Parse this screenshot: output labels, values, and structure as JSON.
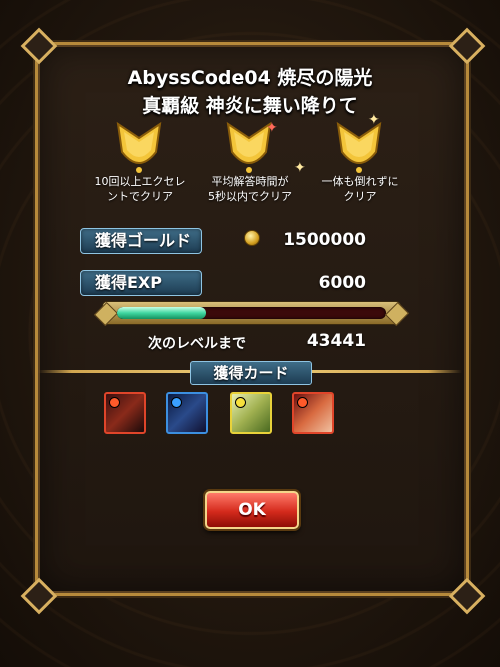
{
  "title": {
    "line1": "AbyssCode04 焼尽の陽光",
    "line2": "真覇級 神炎に舞い降りて"
  },
  "medals": [
    {
      "icon": "gold-crown-medal-icon",
      "label_l1": "10回以上エクセレ",
      "label_l2": "ントでクリア"
    },
    {
      "icon": "gold-crown-medal-icon",
      "label_l1": "平均解答時間が",
      "label_l2": "5秒以内でクリア"
    },
    {
      "icon": "gold-crown-medal-icon",
      "label_l1": "一体も倒れずに",
      "label_l2": "クリア"
    }
  ],
  "gold": {
    "label": "獲得ゴールド",
    "value": "1500000",
    "icon": "gold-coin-icon"
  },
  "exp": {
    "label": "獲得EXP",
    "value": "6000",
    "progress": 0.33
  },
  "next_level": {
    "label": "次のレベルまで",
    "value": "43441"
  },
  "cards": {
    "label": "獲得カード",
    "items": [
      {
        "name": "card-dark-beast",
        "element": "fire",
        "frame_color": "#e0452a",
        "orb_color": "#ff5a2a"
      },
      {
        "name": "card-blue-dragon",
        "element": "water",
        "frame_color": "#3c8fe0",
        "orb_color": "#3aa0ff"
      },
      {
        "name": "card-light-mech",
        "element": "thunder",
        "frame_color": "#e8d23a",
        "orb_color": "#f7e03c"
      },
      {
        "name": "card-fire-priestess",
        "element": "fire",
        "frame_color": "#e0452a",
        "orb_color": "#ff5a2a"
      }
    ]
  },
  "ok_button": {
    "label": "OK"
  },
  "colors": {
    "panel_border": "#b78a3b",
    "label_box": "#2b5570",
    "ok_button": "#d42a1c",
    "exp_fill": "#40d7a0"
  }
}
